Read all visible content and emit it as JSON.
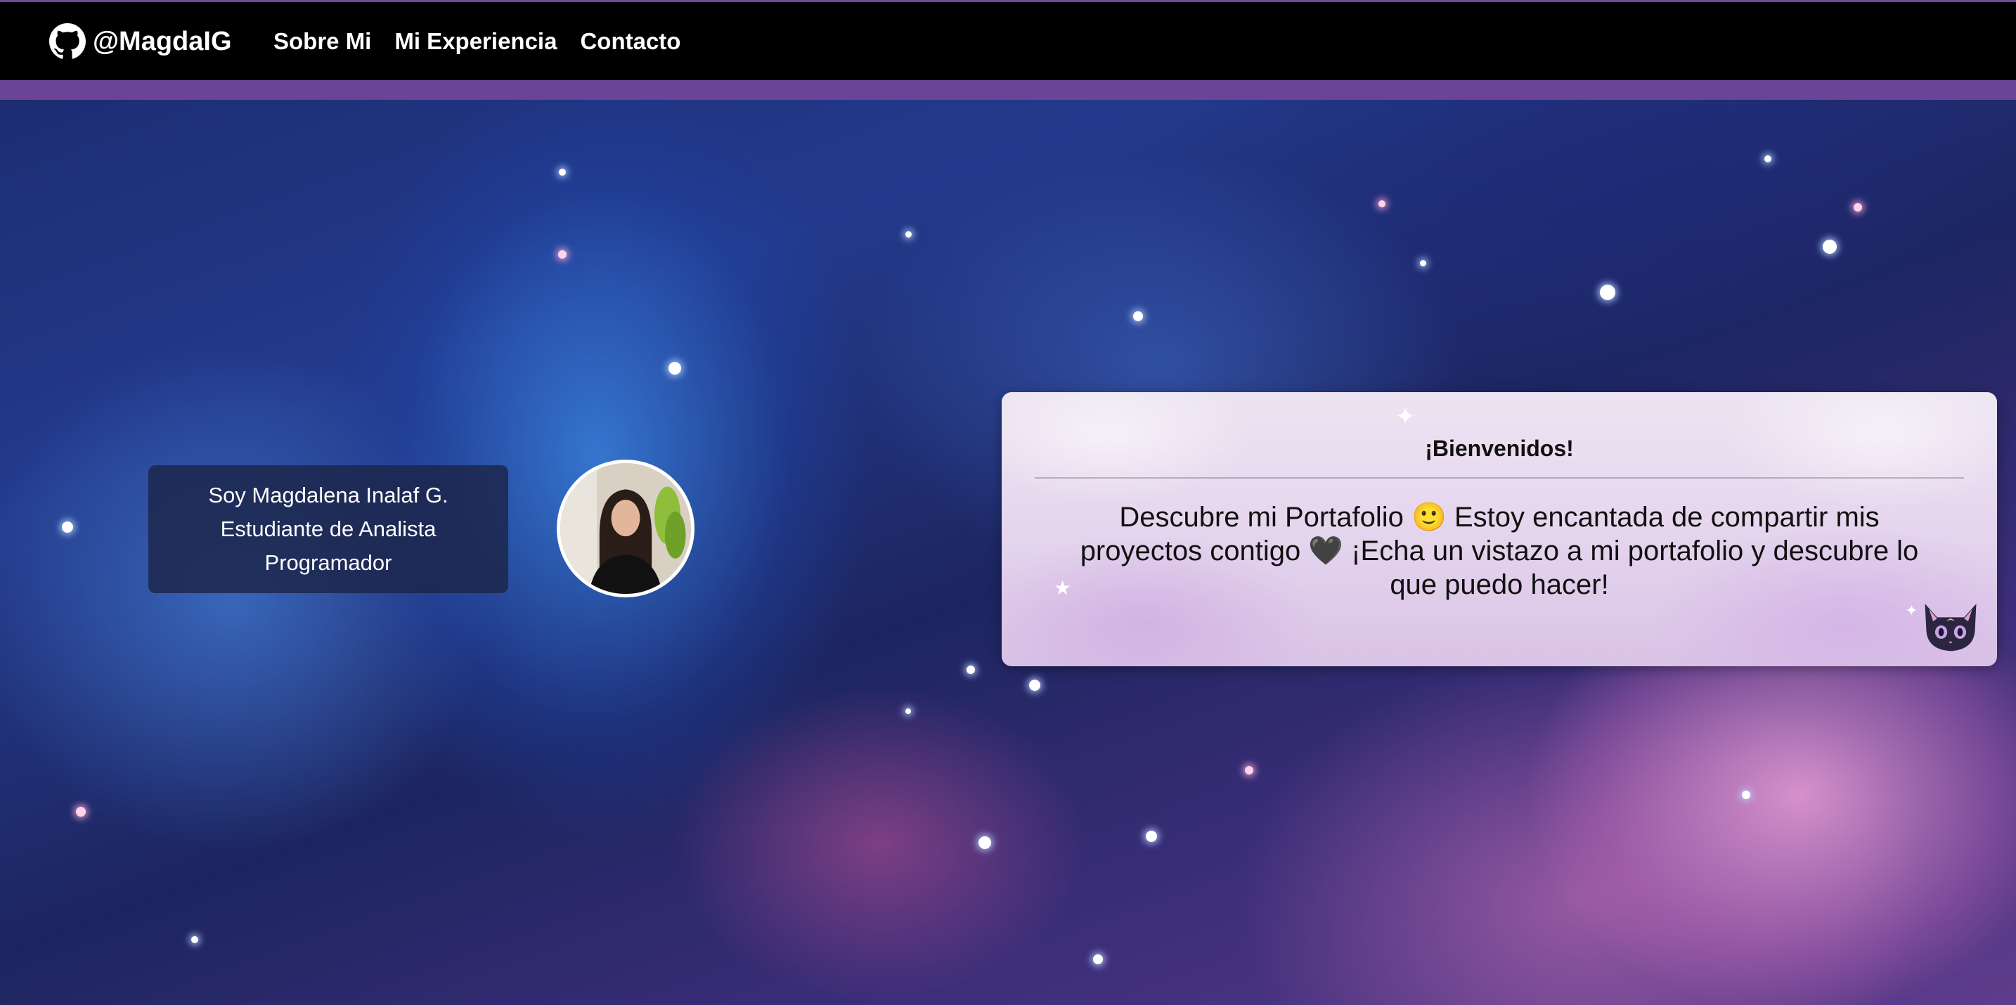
{
  "navbar": {
    "brand_icon": "github-icon",
    "brand_label": "@MagdaIG",
    "links": [
      {
        "label": "Sobre Mi"
      },
      {
        "label": "Mi Experiencia"
      },
      {
        "label": "Contacto"
      }
    ],
    "accent_color": "#6b4497"
  },
  "intro": {
    "line1": "Soy Magdalena Inalaf G.",
    "line2": "Estudiante de Analista",
    "line3": "Programador"
  },
  "avatar": {
    "icon": "profile-photo"
  },
  "welcome": {
    "title": "¡Bienvenidos!",
    "body": "Descubre mi Portafolio 🙂 Estoy encantada de compartir mis proyectos contigo 🖤 ¡Echa un vistazo a mi portafolio y descubre lo que puedo hacer!",
    "decoration_icon": "black-cat-icon"
  }
}
